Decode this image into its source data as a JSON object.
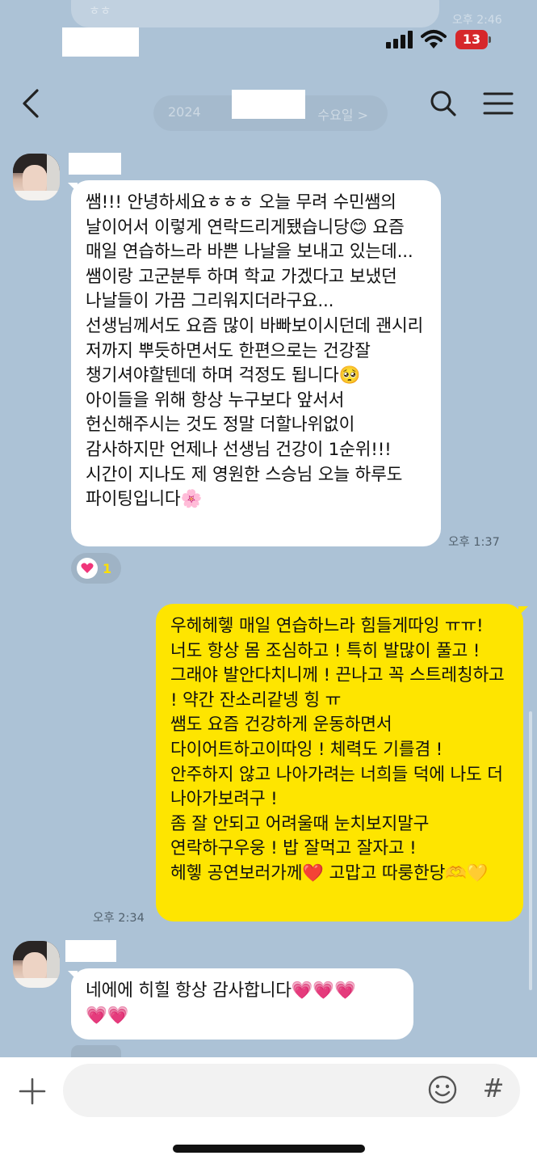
{
  "ghost": {
    "prev_text": "ㅎㅎ",
    "prev_time": "오후 2:46",
    "date_left": "2024",
    "date_right": "수요일 >"
  },
  "status": {
    "battery": "13"
  },
  "messages": [
    {
      "side": "left",
      "text": "쌤!!! 안녕하세요ㅎㅎㅎ 오늘 무려 수민쌤의 날이어서 이렇게 연락드리게됐습니당😊 요즘 매일 연습하느라 바쁜 나날을 보내고 있는데...\n쌤이랑 고군분투 하며 학교 가겠다고 보냈던 나날들이 가끔 그리워지더라구요...\n선생님께서도 요즘 많이 바빠보이시던데 괜시리 저까지 뿌듯하면서도 한편으로는 건강잘 챙기셔야할텐데 하며 걱정도 됩니다🥺 아이들을 위해 항상 누구보다 앞서서 헌신해주시는 것도 정말 더할나위없이 감사하지만 언제나 선생님 건강이 1순위!!! 시간이 지나도 제 영원한 스승님 오늘 하루도 파이팅입니다🌸",
      "time": "오후 1:37",
      "reaction_count": "1"
    },
    {
      "side": "right",
      "text": "우헤헤헿 매일 연습하느라 힘들게따잉 ㅠㅠ! 너도 항상 몸 조심하고 ! 특히 발많이 풀고 ! 그래야 발안다치니께 ! 끈나고 꼭 스트레칭하고 ! 약간 잔소리같넹 힝 ㅠ\n쌤도 요즘 건강하게 운동하면서 다이어트하고이따잉 ! 체력도 기를겸 !\n안주하지 않고 나아가려는 너희들 덕에 나도 더 나아가보려구 !\n좀 잘 안되고 어려울때 눈치보지말구 연락하구우웅 ! 밥 잘먹고 잘자고 !\n헤헿 공연보러가께❤️ 고맙고 따룽한당🫶💛",
      "time": "오후 2:34"
    },
    {
      "side": "left",
      "text": "네에에 히힐 항상 감사합니다💗💗💗\n💗💗",
      "time": ""
    }
  ],
  "composer": {
    "placeholder": "",
    "hash": "#"
  },
  "icons": [
    "back-arrow-icon",
    "search-icon",
    "menu-icon",
    "plus-icon",
    "emoji-icon",
    "hash-icon",
    "heart-icon"
  ],
  "colors": {
    "background": "#acc2d6",
    "my_bubble": "#fee500",
    "their_bubble": "#ffffff",
    "reaction_heart": "#f0357a",
    "battery": "#d6272b"
  }
}
